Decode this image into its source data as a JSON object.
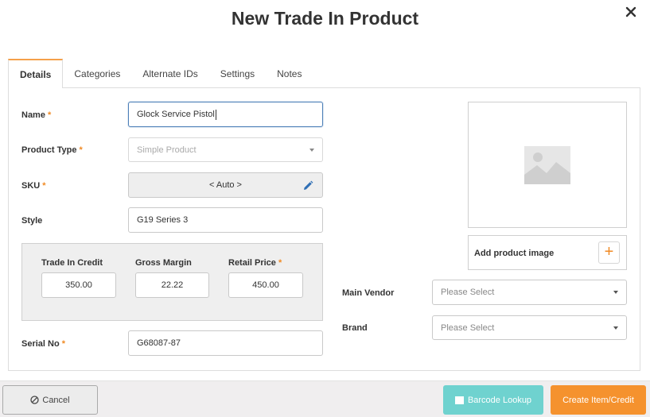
{
  "dialog": {
    "title": "New Trade In Product"
  },
  "tabs": [
    {
      "label": "Details",
      "active": true
    },
    {
      "label": "Categories"
    },
    {
      "label": "Alternate IDs"
    },
    {
      "label": "Settings"
    },
    {
      "label": "Notes"
    }
  ],
  "required_marker": "*",
  "form": {
    "name": {
      "label": "Name",
      "value": "Glock Service Pistol"
    },
    "product_type": {
      "label": "Product Type",
      "value": "Simple Product"
    },
    "sku": {
      "label": "SKU",
      "value": "< Auto >"
    },
    "style": {
      "label": "Style",
      "value": "G19 Series 3"
    },
    "trade_in_credit": {
      "label": "Trade In Credit",
      "value": "350.00"
    },
    "gross_margin": {
      "label": "Gross Margin",
      "value": "22.22"
    },
    "retail_price": {
      "label": "Retail Price",
      "value": "450.00"
    },
    "serial_no": {
      "label": "Serial No",
      "value": "G68087-87"
    }
  },
  "image": {
    "add_label": "Add product image",
    "add_button": "+"
  },
  "main_vendor": {
    "label": "Main Vendor",
    "placeholder": "Please Select"
  },
  "brand": {
    "label": "Brand",
    "placeholder": "Please Select"
  },
  "footer": {
    "cancel_label": "Cancel",
    "barcode_label": "Barcode Lookup",
    "create_label": "Create Item/Credit"
  },
  "colors": {
    "accent_orange": "#f5922e",
    "teal": "#6fd2cf",
    "required": "#f08a24"
  }
}
